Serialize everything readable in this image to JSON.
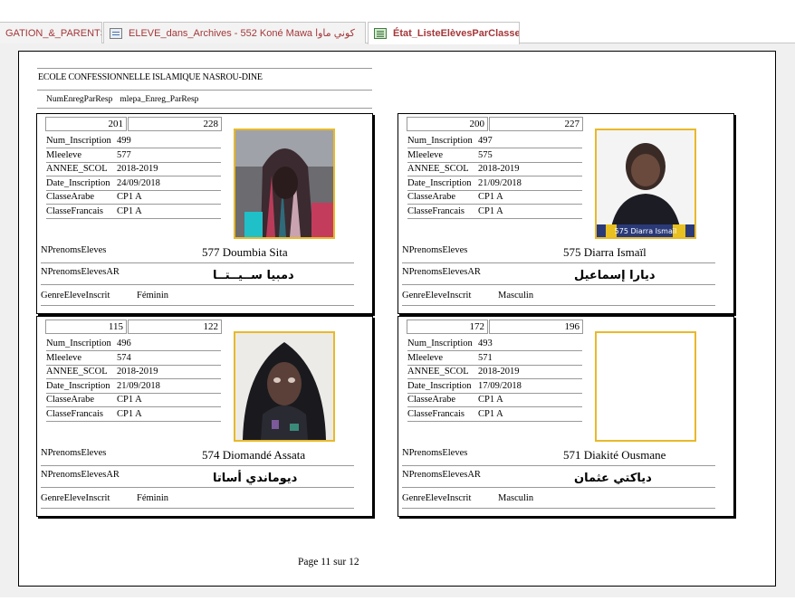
{
  "tabs": [
    {
      "label": "GATION_&_PARENTS",
      "icon": "none"
    },
    {
      "label": "ELEVE_dans_Archives -  552 Koné Mawa كوني ماوا",
      "icon": "form-icon"
    },
    {
      "label": "État_ListeElèvesParClasse",
      "icon": "report-icon"
    }
  ],
  "report": {
    "school": "ECOLE CONFESSIONNELLE ISLAMIQUE NASROU-DINE",
    "group_label": "NumEnregParResp",
    "group_value": "mlepa_Enreg_ParResp",
    "labels": {
      "num_inscription": "Num_Inscription",
      "mleeleve": "Mleeleve",
      "annee": "ANNEE_SCOL",
      "date_inscription": "Date_Inscription",
      "classe_arabe": "ClasseArabe",
      "classe_francais": "ClasseFrancais",
      "nprenoms": "NPrenomsEleves",
      "nprenoms_ar": "NPrenomsElevesAR",
      "genre": "GenreEleveInscrit"
    },
    "students": [
      {
        "n1": "201",
        "n2": "228",
        "num_inscription": "499",
        "mleeleve": "577",
        "annee": "2018-2019",
        "date_inscription": "24/09/2018",
        "classe_arabe": "CP1 A",
        "classe_francais": "CP1 A",
        "name": "577 Doumbia Sita",
        "name_ar": "دمبيا ســيــتــا",
        "genre": "Féminin",
        "photo": "girl-veil-striped"
      },
      {
        "n1": "200",
        "n2": "227",
        "num_inscription": "497",
        "mleeleve": "575",
        "annee": "2018-2019",
        "date_inscription": "21/09/2018",
        "classe_arabe": "CP1 A",
        "classe_francais": "CP1 A",
        "name": "575 Diarra Ismaïl",
        "name_ar": "ديارا إسماعيل",
        "genre": "Masculin",
        "photo": "boy",
        "photo_caption": "575 Diarra Ismaïl"
      },
      {
        "n1": "115",
        "n2": "122",
        "num_inscription": "496",
        "mleeleve": "574",
        "annee": "2018-2019",
        "date_inscription": "21/09/2018",
        "classe_arabe": "CP1 A",
        "classe_francais": "CP1 A",
        "name": "574 Diomandé Assata",
        "name_ar": "ديوماندي أساتا",
        "genre": "Féminin",
        "photo": "girl-veil-dark"
      },
      {
        "n1": "172",
        "n2": "196",
        "num_inscription": "493",
        "mleeleve": "571",
        "annee": "2018-2019",
        "date_inscription": "17/09/2018",
        "classe_arabe": "CP1 A",
        "classe_francais": "CP1 A",
        "name": "571 Diakité Ousmane",
        "name_ar": "دياكتي عثمان",
        "genre": "Masculin",
        "photo": "empty"
      }
    ],
    "page_label": "Page 11 sur 12"
  },
  "colors": {
    "photo_border": "#e8b92a",
    "tab_text": "#a4373a"
  }
}
